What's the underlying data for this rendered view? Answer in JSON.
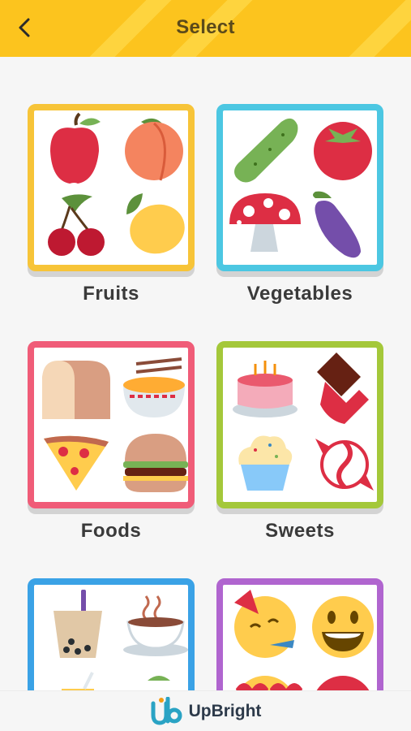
{
  "header": {
    "title": "Select",
    "background": "#fcc41e"
  },
  "categories": [
    {
      "label": "Fruits",
      "color": "#f7c438"
    },
    {
      "label": "Vegetables",
      "color": "#4cc7e2"
    },
    {
      "label": "Foods",
      "color": "#f05c78"
    },
    {
      "label": "Sweets",
      "color": "#a4c83a"
    },
    {
      "label": "",
      "color": "#3aa2e6"
    },
    {
      "label": "",
      "color": "#b065cf"
    }
  ],
  "footer": {
    "brand": "UpBright",
    "brand_color": "#2aa3c4"
  }
}
